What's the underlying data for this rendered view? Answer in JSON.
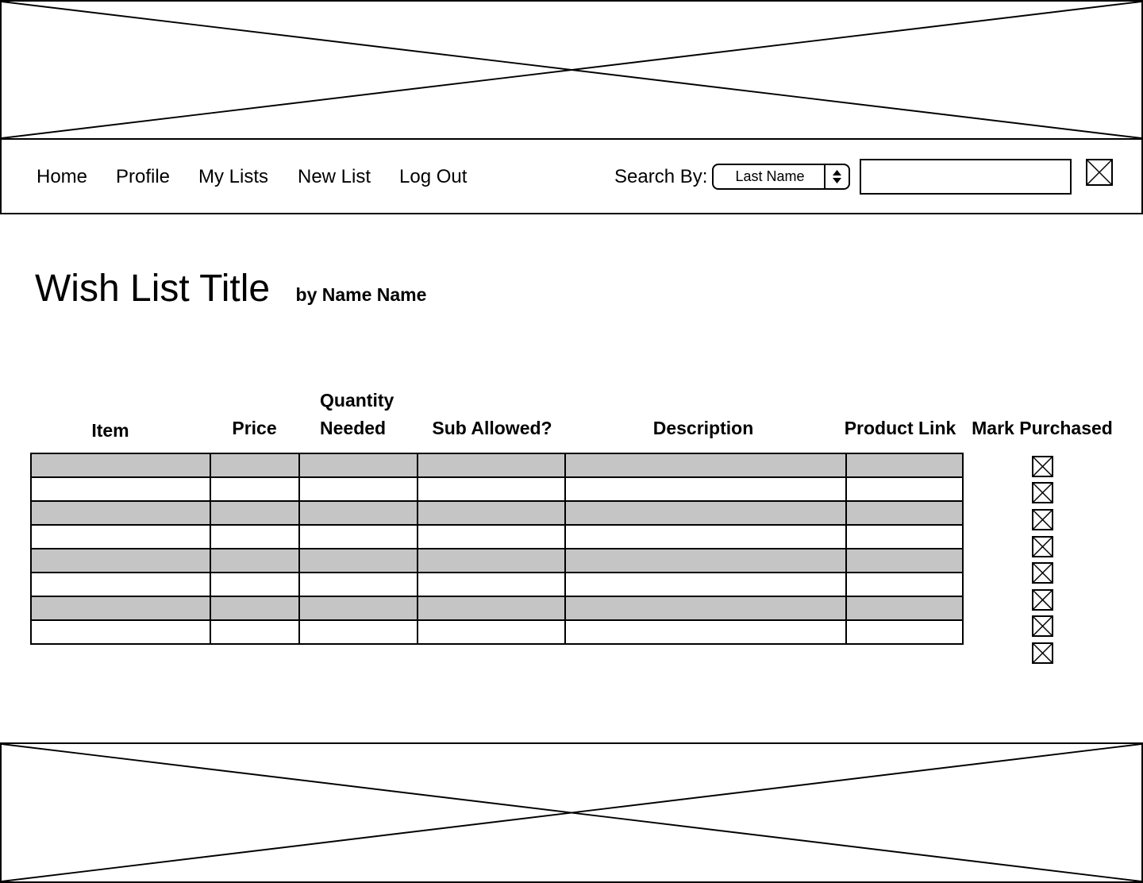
{
  "header": {
    "banner": "image-placeholder"
  },
  "nav": {
    "links": [
      "Home",
      "Profile",
      "My Lists",
      "New List",
      "Log Out"
    ],
    "search_label": "Search By:",
    "search_by_selected": "Last Name",
    "search_input_value": "",
    "search_button_icon": "image-placeholder-icon"
  },
  "page": {
    "title": "Wish List Title",
    "byline": "by Name Name"
  },
  "table": {
    "headers": {
      "item": "Item",
      "price": "Price",
      "quantity_line1": "Quantity",
      "quantity_line2": "Needed",
      "sub_allowed": "Sub Allowed?",
      "description": "Description",
      "product_link": "Product Link",
      "mark_purchased": "Mark Purchased"
    },
    "rows": [
      {
        "item": "",
        "price": "",
        "quantity": "",
        "sub_allowed": "",
        "description": "",
        "product_link": "",
        "purchased": false
      },
      {
        "item": "",
        "price": "",
        "quantity": "",
        "sub_allowed": "",
        "description": "",
        "product_link": "",
        "purchased": false
      },
      {
        "item": "",
        "price": "",
        "quantity": "",
        "sub_allowed": "",
        "description": "",
        "product_link": "",
        "purchased": false
      },
      {
        "item": "",
        "price": "",
        "quantity": "",
        "sub_allowed": "",
        "description": "",
        "product_link": "",
        "purchased": false
      },
      {
        "item": "",
        "price": "",
        "quantity": "",
        "sub_allowed": "",
        "description": "",
        "product_link": "",
        "purchased": false
      },
      {
        "item": "",
        "price": "",
        "quantity": "",
        "sub_allowed": "",
        "description": "",
        "product_link": "",
        "purchased": false
      },
      {
        "item": "",
        "price": "",
        "quantity": "",
        "sub_allowed": "",
        "description": "",
        "product_link": "",
        "purchased": false
      },
      {
        "item": "",
        "price": "",
        "quantity": "",
        "sub_allowed": "",
        "description": "",
        "product_link": "",
        "purchased": false
      }
    ],
    "shaded_row_color": "#c5c5c5"
  },
  "footer": {
    "banner": "image-placeholder"
  }
}
